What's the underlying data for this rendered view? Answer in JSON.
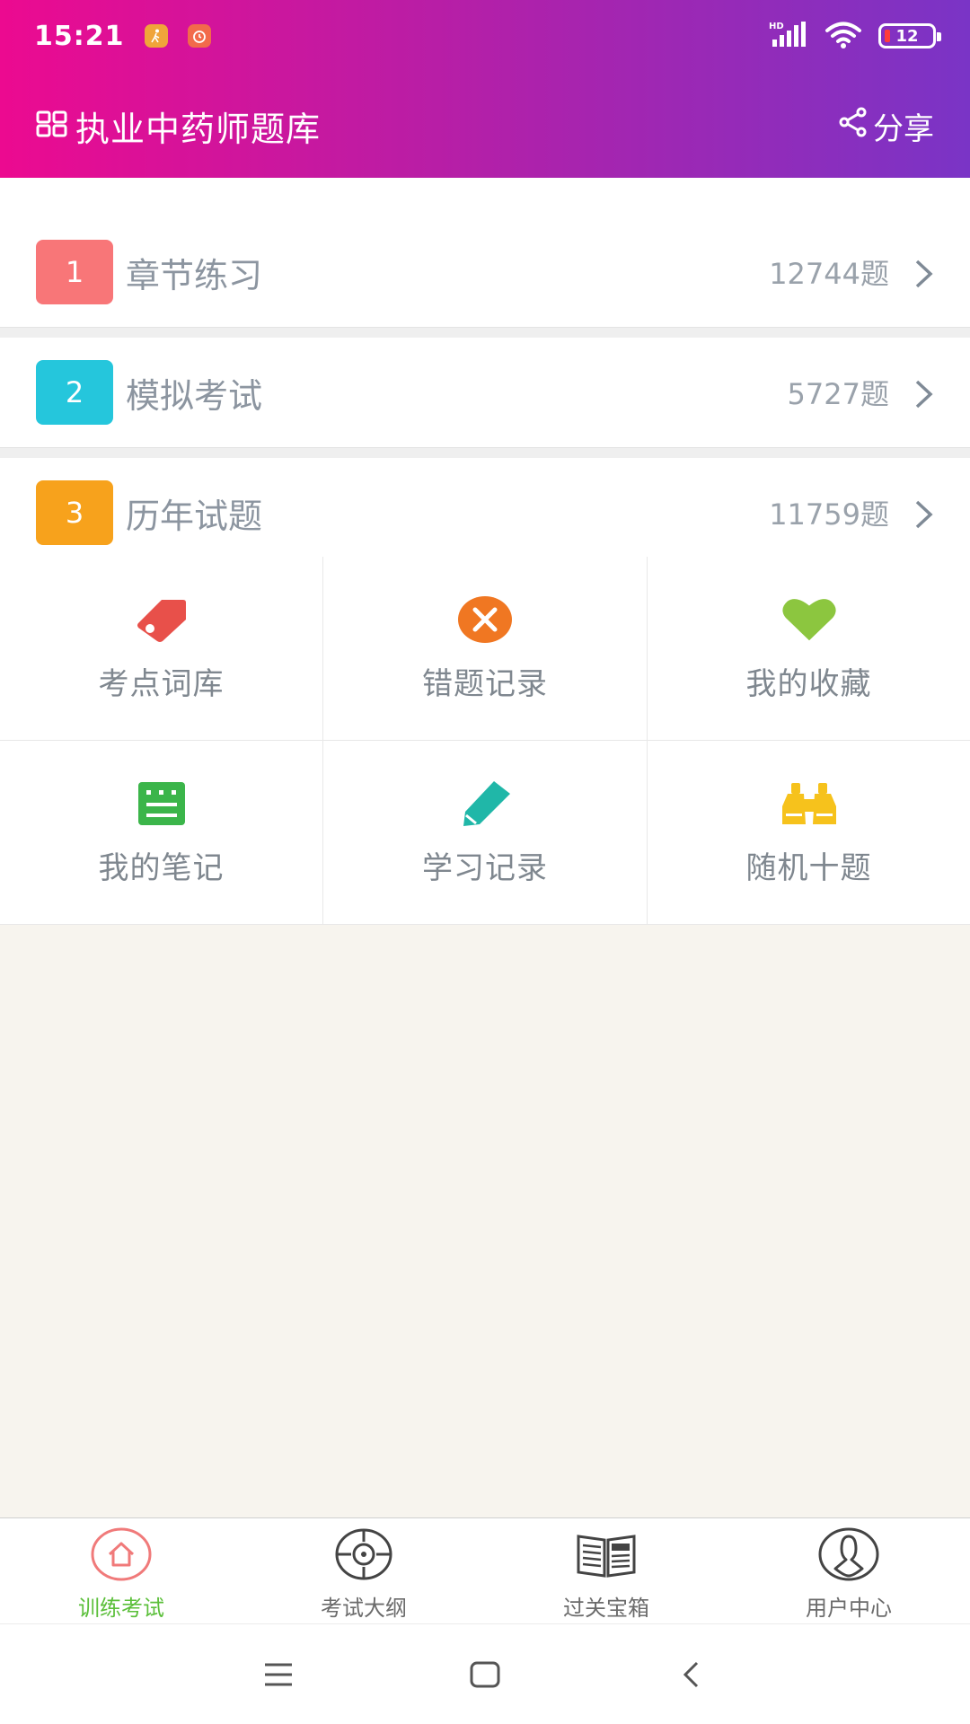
{
  "status_bar": {
    "time": "15:21",
    "network": "HD",
    "battery": "12"
  },
  "header": {
    "title": "执业中药师题库",
    "share_label": "分享"
  },
  "list": [
    {
      "number": "1",
      "label": "章节练习",
      "count": "12744题",
      "color": "#f87678"
    },
    {
      "number": "2",
      "label": "模拟考试",
      "count": "5727题",
      "color": "#25c6dc"
    },
    {
      "number": "3",
      "label": "历年试题",
      "count": "11759题",
      "color": "#f7a21c"
    }
  ],
  "grid": [
    {
      "label": "考点词库",
      "icon": "tag-icon",
      "color": "#e8504a"
    },
    {
      "label": "错题记录",
      "icon": "error-circle-icon",
      "color": "#f07722"
    },
    {
      "label": "我的收藏",
      "icon": "heart-icon",
      "color": "#8cc63f"
    },
    {
      "label": "我的笔记",
      "icon": "note-icon",
      "color": "#3bb54a"
    },
    {
      "label": "学习记录",
      "icon": "pencil-icon",
      "color": "#20b7a8"
    },
    {
      "label": "随机十题",
      "icon": "binoculars-icon",
      "color": "#f6c21c"
    }
  ],
  "tabs": [
    {
      "label": "训练考试",
      "icon": "home-icon",
      "active": true
    },
    {
      "label": "考试大纲",
      "icon": "target-icon",
      "active": false
    },
    {
      "label": "过关宝箱",
      "icon": "news-book-icon",
      "active": false
    },
    {
      "label": "用户中心",
      "icon": "user-icon",
      "active": false
    }
  ]
}
